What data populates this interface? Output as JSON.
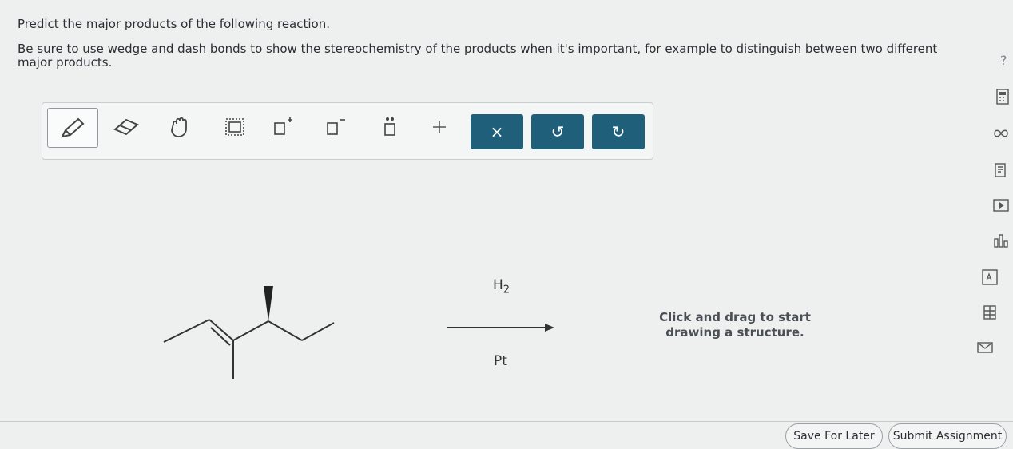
{
  "prompt": {
    "line1": "Predict the major products of the following reaction.",
    "line2": "Be sure to use wedge and dash bonds to show the stereochemistry of the products when it's important, for example to distinguish between two different major products."
  },
  "toolbar": {
    "tools": [
      "pencil-icon",
      "eraser-icon",
      "hand-icon",
      "select-box-icon",
      "charge-plus-icon",
      "charge-minus-icon",
      "lone-pair-icon",
      "plus-icon"
    ],
    "clear_label": "×",
    "undo_label": "↺",
    "redo_label": "↻",
    "accent": "#1f5f7a"
  },
  "reaction": {
    "reagent_top": "H",
    "reagent_top_sub": "2",
    "reagent_bottom": "Pt"
  },
  "canvas": {
    "hint_line1": "Click and drag to start",
    "hint_line2": "drawing a structure."
  },
  "side": {
    "help": "?",
    "icons": [
      "calculator-icon",
      "infinity-icon",
      "notes-icon",
      "play-icon",
      "chart-icon",
      "periodic-table-icon",
      "grid-icon",
      "mail-icon"
    ]
  },
  "footer": {
    "save_label": "Save For Later",
    "submit_label": "Submit Assignment"
  }
}
